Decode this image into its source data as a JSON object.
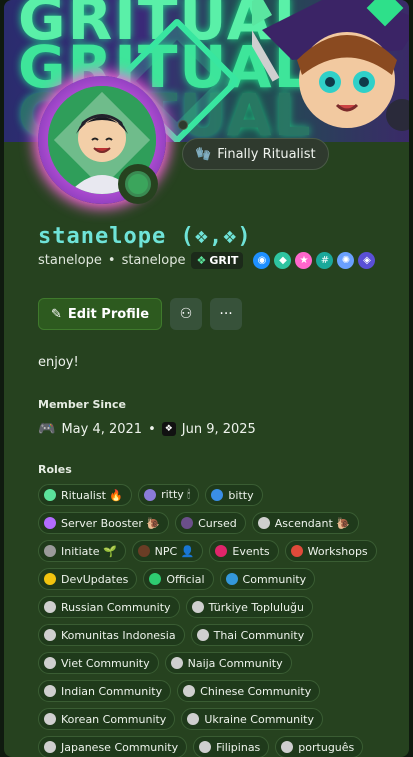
{
  "banner": {
    "text_line1": "GRITUAL",
    "text_line2": "GRITUAL",
    "text_line3": "GRITUAL"
  },
  "profile": {
    "custom_status_emoji": "🧤",
    "custom_status": "Finally Ritualist",
    "display_name": "stanelope (❖,❖)",
    "username": "stanelope",
    "separator": "•",
    "pronouns": "stanelope",
    "guild_tag": "GRIT",
    "bio": "enjoy!"
  },
  "actions": {
    "edit_profile_label": "Edit Profile",
    "more_label": "···"
  },
  "member_since": {
    "heading": "Member Since",
    "discord_date": "May 4, 2021",
    "separator": "•",
    "server_date": "Jun 9, 2025"
  },
  "roles_heading": "Roles",
  "roles": [
    [
      {
        "name": "Ritualist 🔥",
        "color": "#5be39b"
      },
      {
        "name": "ritty 🕯",
        "color": "#8a7bd8"
      },
      {
        "name": "bitty",
        "color": "#3a8ee6"
      }
    ],
    [
      {
        "name": "Server Booster 🐌",
        "color": "#b26bff"
      },
      {
        "name": "Cursed",
        "color": "#6b4f8a"
      },
      {
        "name": "Ascendant 🐌",
        "color": "#cfcfcf"
      }
    ],
    [
      {
        "name": "Initiate 🌱",
        "color": "#9a9a9a"
      },
      {
        "name": "NPC 👤",
        "color": "#6a3d25"
      },
      {
        "name": "Events",
        "color": "#e0256a"
      },
      {
        "name": "Workshops",
        "color": "#e04a3a"
      }
    ],
    [
      {
        "name": "DevUpdates",
        "color": "#f1c40f"
      },
      {
        "name": "Official",
        "color": "#2ecc71"
      },
      {
        "name": "Community",
        "color": "#3498db"
      }
    ],
    [
      {
        "name": "Russian Community",
        "color": "#cfcfcf"
      },
      {
        "name": "Türkiye Topluluğu",
        "color": "#cfcfcf"
      }
    ],
    [
      {
        "name": "Komunitas Indonesia",
        "color": "#cfcfcf"
      },
      {
        "name": "Thai Community",
        "color": "#cfcfcf"
      }
    ],
    [
      {
        "name": "Viet Community",
        "color": "#cfcfcf"
      },
      {
        "name": "Naija Community",
        "color": "#cfcfcf"
      }
    ],
    [
      {
        "name": "Indian Community",
        "color": "#cfcfcf"
      },
      {
        "name": "Chinese Community",
        "color": "#cfcfcf"
      }
    ],
    [
      {
        "name": "Korean Community",
        "color": "#cfcfcf"
      },
      {
        "name": "Ukraine Community",
        "color": "#cfcfcf"
      }
    ],
    [
      {
        "name": "Japanese Community",
        "color": "#cfcfcf"
      },
      {
        "name": "Filipinas",
        "color": "#cfcfcf"
      },
      {
        "name": "português",
        "color": "#cfcfcf"
      }
    ]
  ],
  "badges": [
    {
      "icon": "hypesquad-icon",
      "color": "#1e90ff"
    },
    {
      "icon": "quest-icon",
      "color": "#2ec4a0"
    },
    {
      "icon": "star-icon",
      "color": "#ff66cc"
    },
    {
      "icon": "hashtag-icon",
      "color": "#1aa89a"
    },
    {
      "icon": "boost-icon",
      "color": "#6aa0ff"
    },
    {
      "icon": "nitro-icon",
      "color": "#5a4fd6"
    }
  ]
}
